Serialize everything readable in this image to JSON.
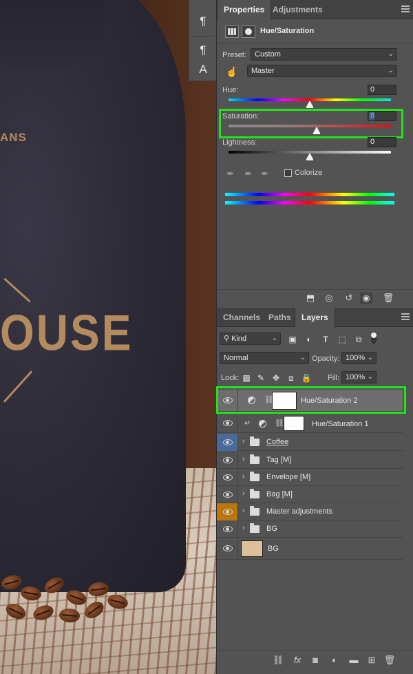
{
  "canvas": {
    "bag_text_partial": "ANS",
    "bag_text_large": "OUSE"
  },
  "mini_toolbar": {
    "icons": [
      "paragraph-icon",
      "paragraph-styles-icon",
      "character-styles-icon"
    ],
    "glyphs": [
      "¶",
      "¶",
      "A"
    ]
  },
  "properties": {
    "tabs": [
      "Properties",
      "Adjustments"
    ],
    "title": "Hue/Saturation",
    "preset_label": "Preset:",
    "preset_value": "Custom",
    "channel_value": "Master",
    "hue_label": "Hue:",
    "hue_value": "0",
    "saturation_label": "Saturation:",
    "saturation_value": "8",
    "lightness_label": "Lightness:",
    "lightness_value": "0",
    "colorize_label": "Colorize",
    "hue_level": 0,
    "saturation_level": 8,
    "lightness_level": 0
  },
  "layers_panel": {
    "tabs": [
      "Channels",
      "Paths",
      "Layers"
    ],
    "filter_kind": "Kind",
    "blend_mode": "Normal",
    "opacity_label": "Opacity:",
    "opacity_value": "100%",
    "lock_label": "Lock:",
    "fill_label": "Fill:",
    "fill_value": "100%",
    "layers": [
      {
        "name": "Hue/Saturation 2",
        "type": "adjustment",
        "selected": true
      },
      {
        "name": "Hue/Saturation 1",
        "type": "adjustment-clipped"
      },
      {
        "name": "Coffee",
        "type": "group",
        "eye_color": "#4a6a9b"
      },
      {
        "name": "Tag [M]",
        "type": "group"
      },
      {
        "name": "Envelope [M]",
        "type": "group"
      },
      {
        "name": "Bag [M]",
        "type": "group"
      },
      {
        "name": "Master adjustments",
        "type": "group",
        "eye_color": "#b9770e"
      },
      {
        "name": "BG",
        "type": "group"
      },
      {
        "name": "BG",
        "type": "pixel",
        "thumb_color": "#dcc09a"
      }
    ]
  },
  "colors": {
    "highlight": "#21e51a",
    "panel_bg": "#535353",
    "tabbar_bg": "#424242"
  }
}
